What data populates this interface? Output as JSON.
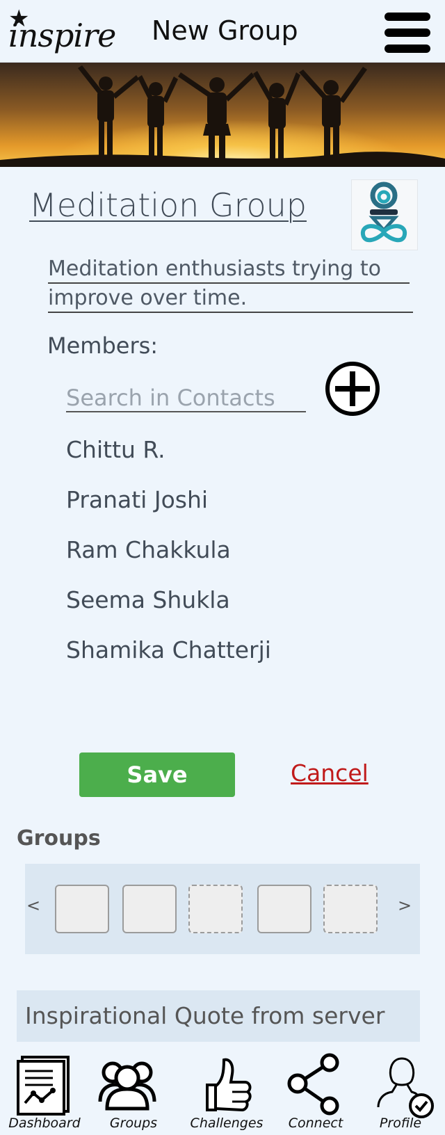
{
  "header": {
    "logo_text": "inspire",
    "title": "New Group"
  },
  "group": {
    "name": "Meditation Group",
    "description": "Meditation enthusiasts trying to improve over time."
  },
  "members": {
    "label": "Members:",
    "search_placeholder": "Search in Contacts",
    "list": [
      "Chittu R.",
      "Pranati Joshi",
      "Ram Chakkula",
      "Seema Shukla",
      "Shamika Chatterji"
    ]
  },
  "actions": {
    "save_label": "Save",
    "cancel_label": "Cancel"
  },
  "groups": {
    "title": "Groups",
    "prev": "<",
    "next": ">"
  },
  "quote": {
    "text": "Inspirational Quote from server"
  },
  "nav": {
    "items": [
      {
        "label": "Dashboard",
        "icon": "dashboard-icon"
      },
      {
        "label": "Groups",
        "icon": "groups-icon"
      },
      {
        "label": "Challenges",
        "icon": "thumbs-up-icon"
      },
      {
        "label": "Connect",
        "icon": "share-icon"
      },
      {
        "label": "Profile",
        "icon": "profile-icon"
      }
    ]
  },
  "colors": {
    "background": "#eef5fc",
    "save_green": "#4cae4c",
    "cancel_red": "#c01a1a",
    "panel": "#dbe7f2"
  }
}
